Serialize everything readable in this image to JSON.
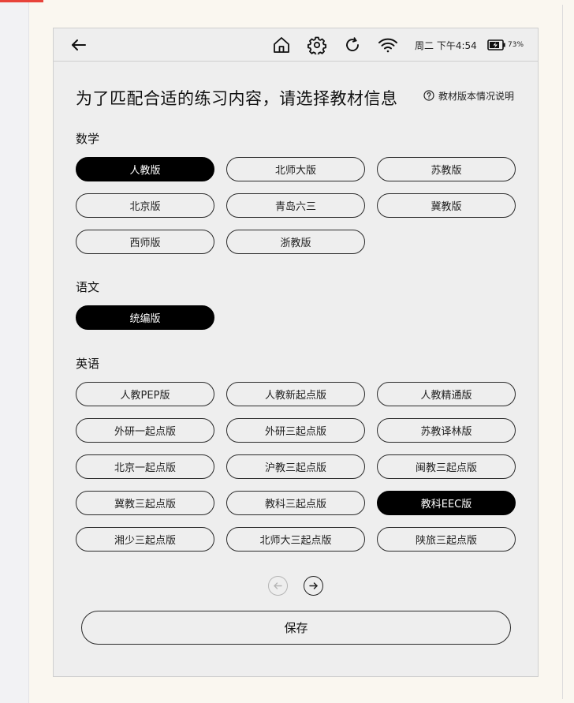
{
  "statusbar": {
    "icons": [
      "back-arrow-icon",
      "home-icon",
      "gear-icon",
      "refresh-icon",
      "wifi-icon",
      "battery-charging-icon"
    ],
    "clock": "周二 下午4:54",
    "battery": "73%"
  },
  "heading": "为了匹配合适的练习内容，请选择教材信息",
  "help_link": "教材版本情况说明",
  "sections": {
    "math": {
      "label": "数学",
      "options": [
        "人教版",
        "北师大版",
        "苏教版",
        "北京版",
        "青岛六三",
        "冀教版",
        "西师版",
        "浙教版"
      ],
      "selected": "人教版"
    },
    "chinese": {
      "label": "语文",
      "options": [
        "统编版"
      ],
      "selected": "统编版"
    },
    "english": {
      "label": "英语",
      "options": [
        "人教PEP版",
        "人教新起点版",
        "人教精通版",
        "外研一起点版",
        "外研三起点版",
        "苏教译林版",
        "北京一起点版",
        "沪教三起点版",
        "闽教三起点版",
        "冀教三起点版",
        "教科三起点版",
        "教科EEC版",
        "湘少三起点版",
        "北师大三起点版",
        "陕旅三起点版"
      ],
      "selected": "教科EEC版"
    }
  },
  "pager": {
    "prev_enabled": false,
    "next_enabled": true
  },
  "save_label": "保存",
  "colors": {
    "selected_bg": "#000000",
    "selected_text": "#ffffff",
    "screen_bg": "#eeeeee",
    "border": "#2a2a2a"
  }
}
